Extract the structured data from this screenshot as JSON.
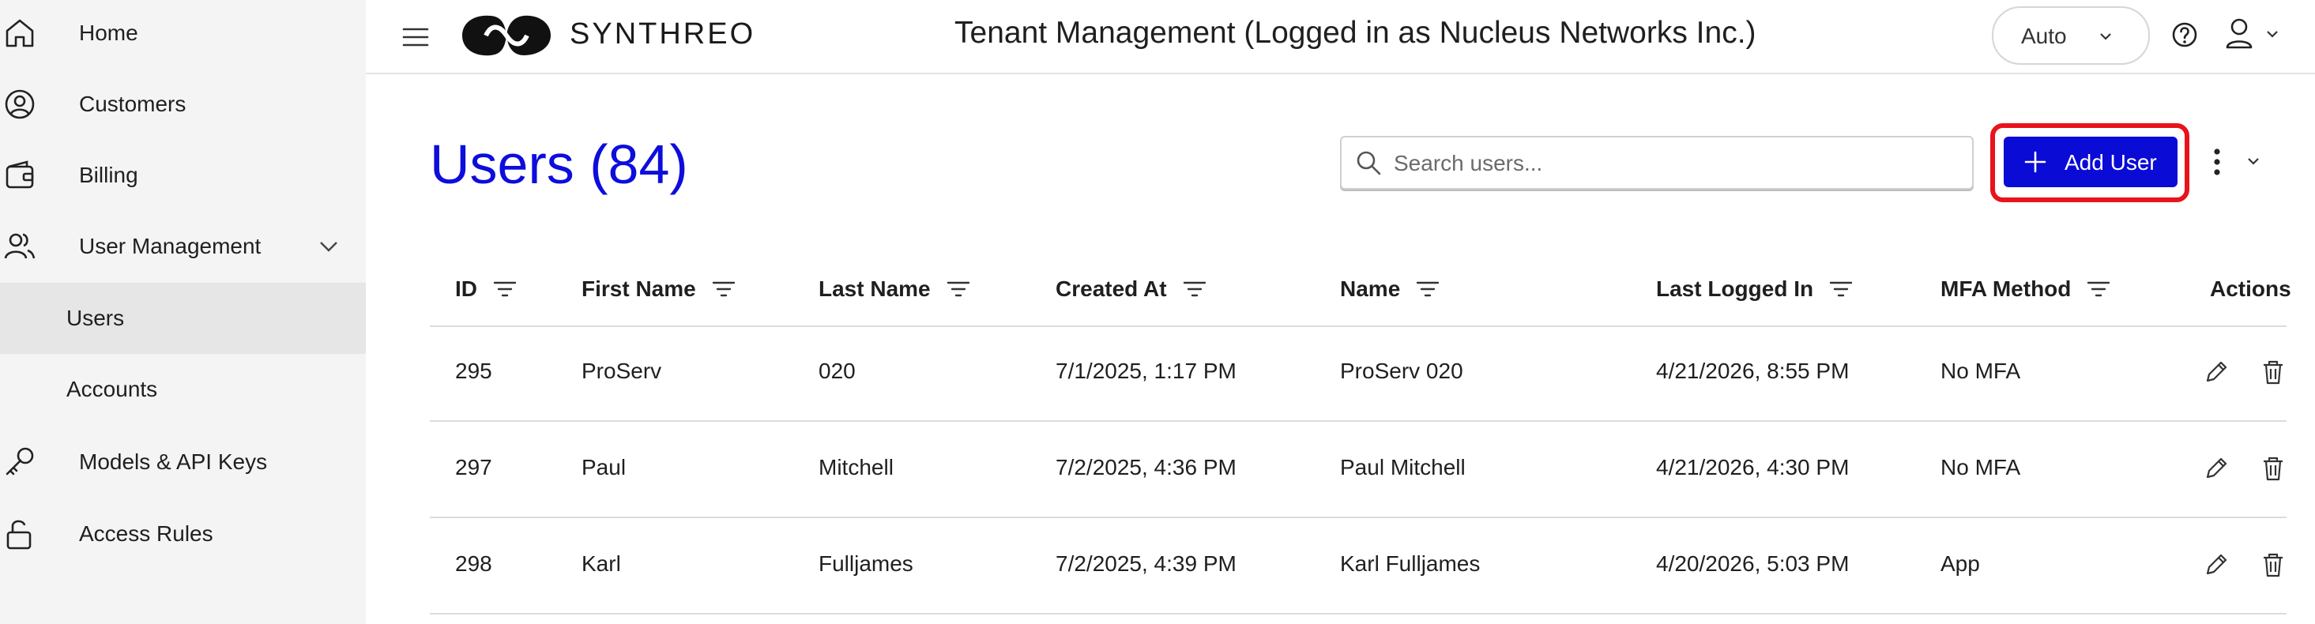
{
  "sidebar": {
    "items": [
      {
        "label": "Home",
        "icon": "home-icon"
      },
      {
        "label": "Customers",
        "icon": "user-circle-icon"
      },
      {
        "label": "Billing",
        "icon": "wallet-icon"
      },
      {
        "label": "User Management",
        "icon": "users-icon",
        "expanded": true
      },
      {
        "label": "Users",
        "sub": true,
        "active": true
      },
      {
        "label": "Accounts",
        "sub": true
      },
      {
        "label": "Models & API Keys",
        "icon": "key-icon"
      },
      {
        "label": "Access Rules",
        "icon": "unlock-icon"
      }
    ]
  },
  "header": {
    "logo_text": "SYNTHREO",
    "title": "Tenant Management (Logged in as Nucleus Networks Inc.)",
    "theme_value": "Auto"
  },
  "main": {
    "title": "Users (84)",
    "search_placeholder": "Search users...",
    "add_button": "Add User",
    "accent_color": "#0b0bd6",
    "highlight_color": "#e8131b"
  },
  "table": {
    "columns": [
      "ID",
      "First Name",
      "Last Name",
      "Created At",
      "Name",
      "Last Logged In",
      "MFA Method",
      "Actions"
    ],
    "rows": [
      {
        "id": "295",
        "first": "ProServ",
        "last": "020",
        "created": "7/1/2025, 1:17 PM",
        "name": "ProServ 020",
        "last_login": "4/21/2026, 8:55 PM",
        "mfa": "No MFA"
      },
      {
        "id": "297",
        "first": "Paul",
        "last": "Mitchell",
        "created": "7/2/2025, 4:36 PM",
        "name": "Paul Mitchell",
        "last_login": "4/21/2026, 4:30 PM",
        "mfa": "No MFA"
      },
      {
        "id": "298",
        "first": "Karl",
        "last": "Fulljames",
        "created": "7/2/2025, 4:39 PM",
        "name": "Karl Fulljames",
        "last_login": "4/20/2026, 5:03 PM",
        "mfa": "App"
      }
    ]
  }
}
